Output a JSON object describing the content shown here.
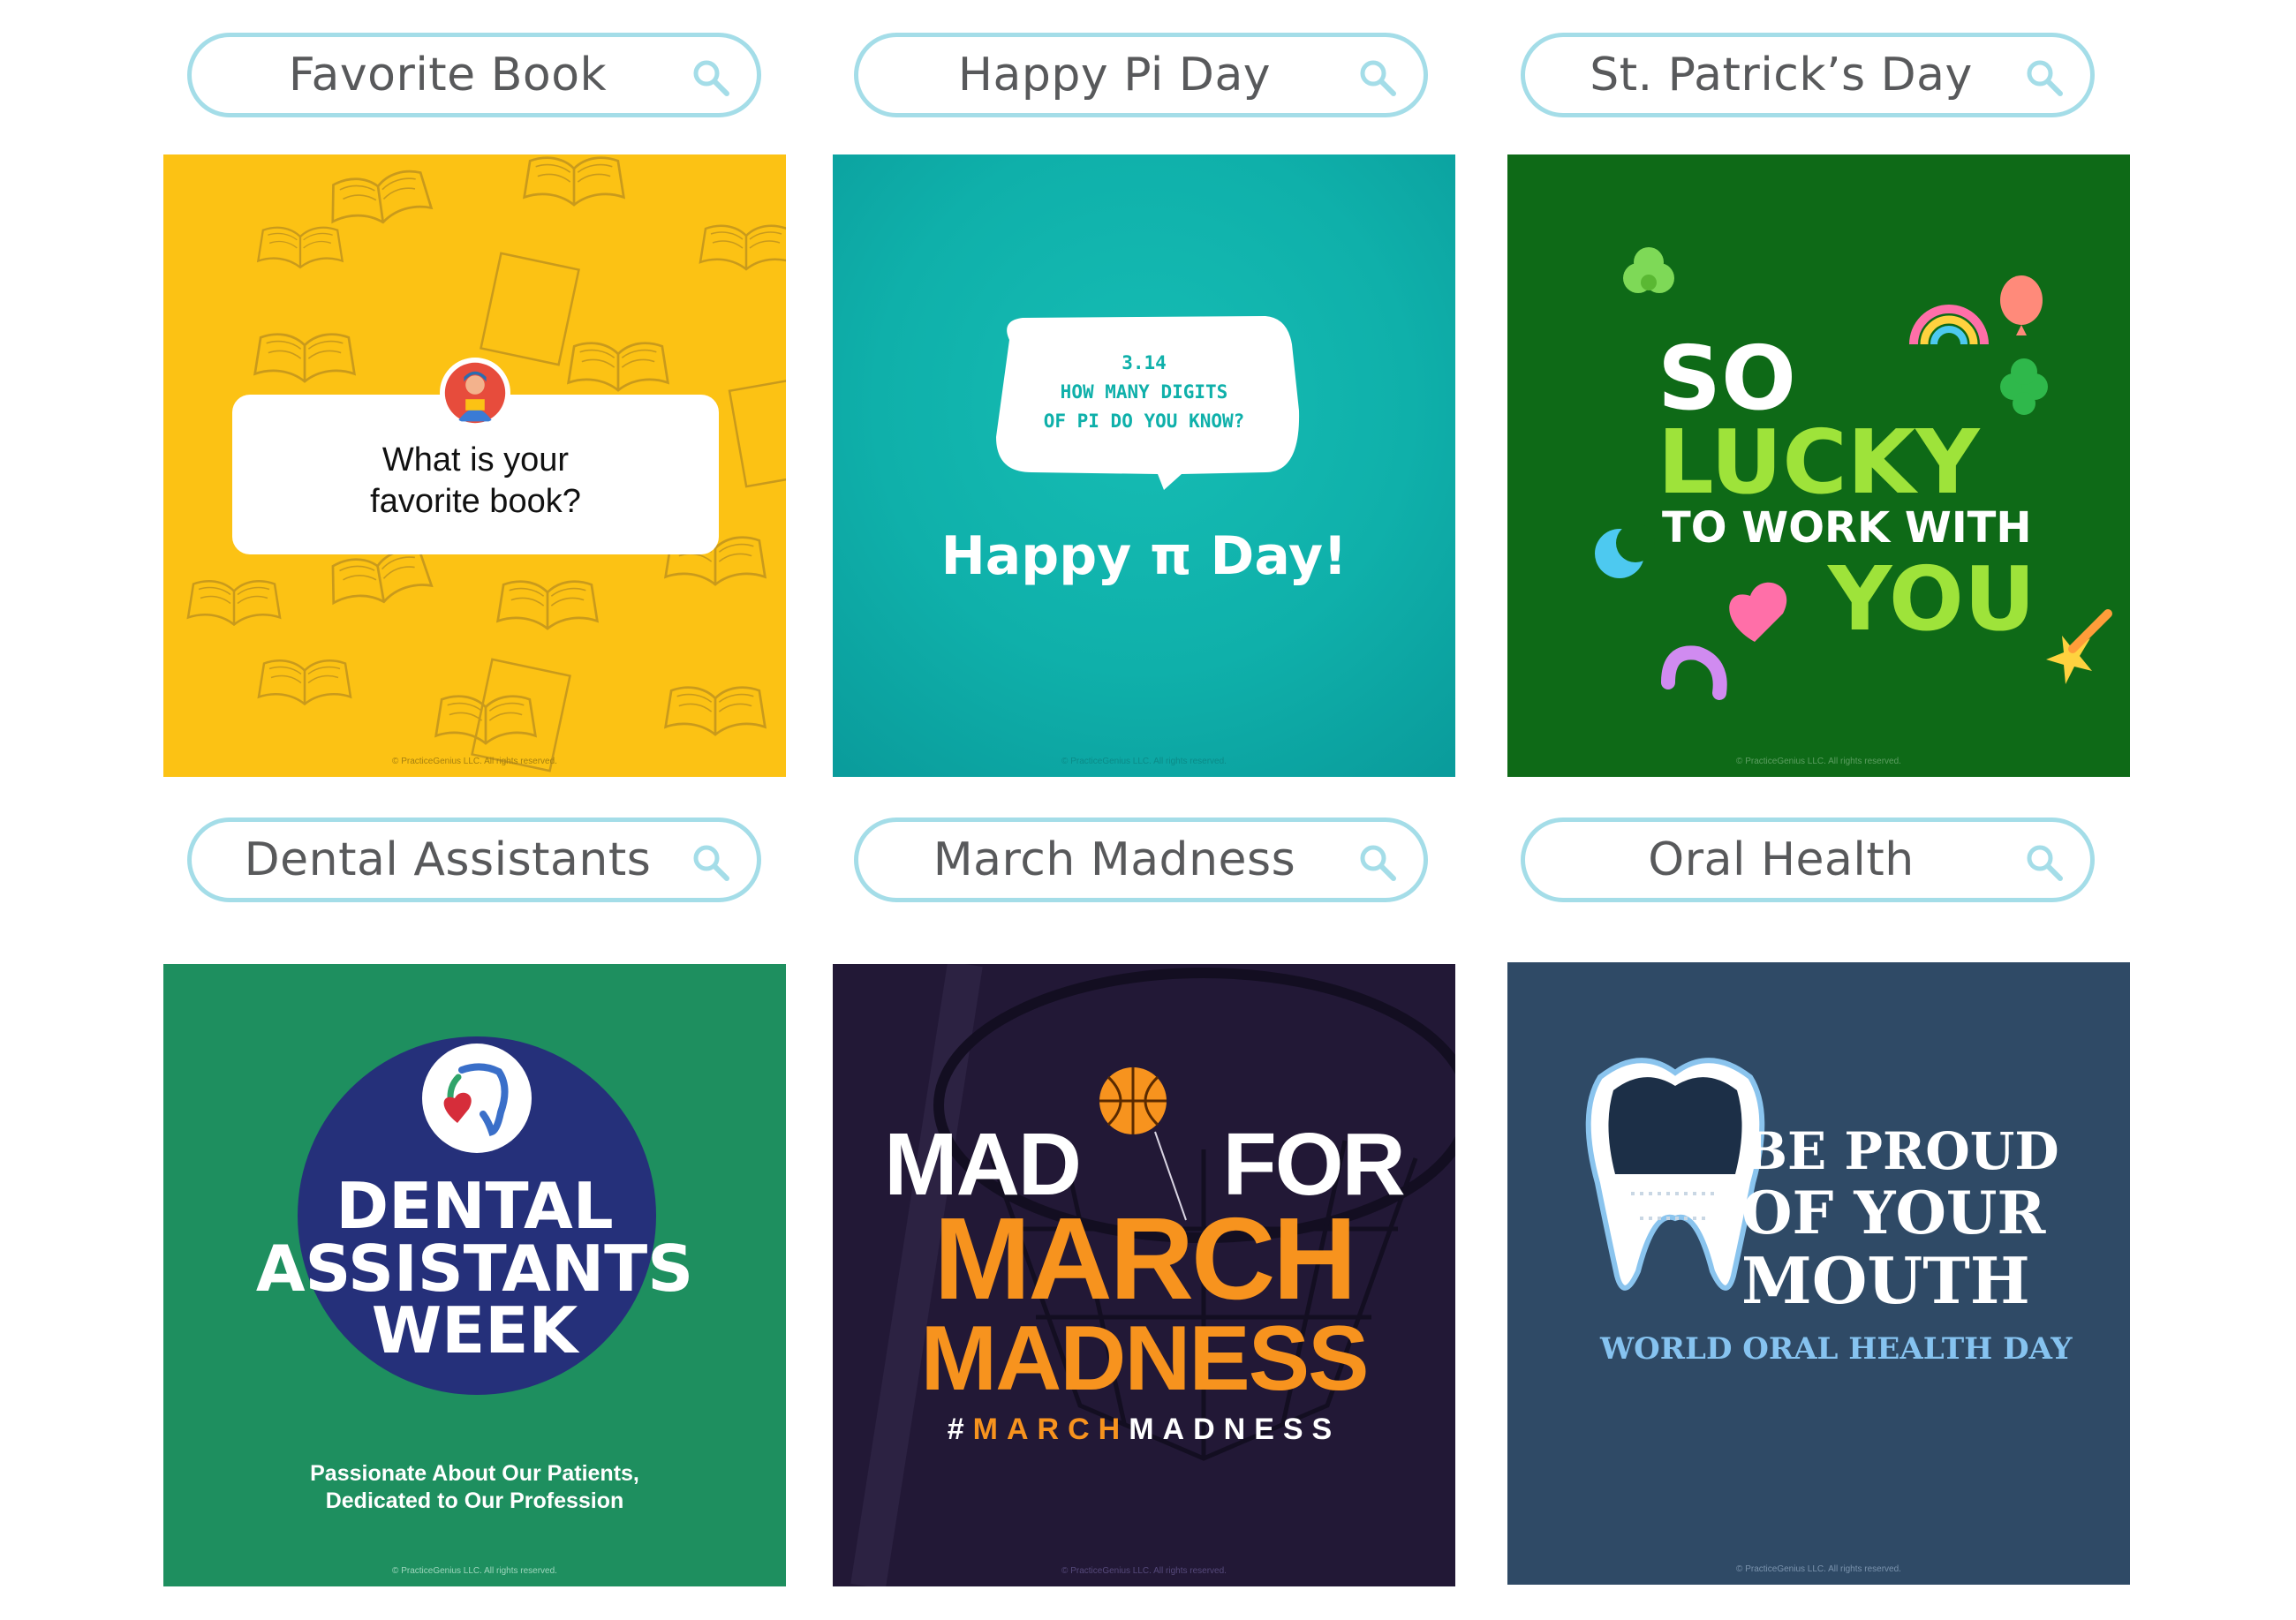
{
  "colors": {
    "pill_border": "#a4dde8",
    "pill_text": "#58595b",
    "search_icon": "#a4dde8"
  },
  "search_pills": [
    {
      "label": "Favorite Book",
      "icon": "search-icon"
    },
    {
      "label": "Happy Pi Day",
      "icon": "search-icon"
    },
    {
      "label": "St. Patrick’s Day",
      "icon": "search-icon"
    },
    {
      "label": "Dental Assistants",
      "icon": "search-icon"
    },
    {
      "label": "March Madness",
      "icon": "search-icon"
    },
    {
      "label": "Oral Health",
      "icon": "search-icon"
    }
  ],
  "tiles": {
    "favorite_book": {
      "question": "What is your\nfavorite book?",
      "background": "#fcc214",
      "copyright": "© PracticeGenius LLC. All rights reserved."
    },
    "pi_day": {
      "bubble": "3.14\nHOW MANY DIGITS\nOF PI DO YOU KNOW?",
      "title": "Happy π Day!",
      "background": "#0fb0aa",
      "copyright": "© PracticeGenius LLC. All rights reserved."
    },
    "st_patricks": {
      "line1": "SO",
      "line2": "LUCKY",
      "line3": "TO WORK WITH",
      "line4": "YOU",
      "background": "#0e6a17",
      "copyright": "© PracticeGenius LLC. All rights reserved."
    },
    "dental_assistants": {
      "line1": "DENTAL",
      "line2": "ASSISTANTS",
      "line3": "WEEK",
      "tagline1": "Passionate About Our Patients,",
      "tagline2": "Dedicated to Our Profession",
      "background": "#1e8f5f",
      "copyright": "© PracticeGenius LLC. All rights reserved."
    },
    "march_madness": {
      "line1_left": "MAD",
      "line1_right": "FOR",
      "line2": "MARCH",
      "line3": "MADNESS",
      "hashtag_hash": "#",
      "hashtag_part1": "MARCH",
      "hashtag_part2": "MADNESS",
      "background": "#221836",
      "copyright": "© PracticeGenius LLC. All rights reserved."
    },
    "oral_health": {
      "line1": "BE PROUD",
      "line2": "OF YOUR",
      "line3": "MOUTH",
      "subtitle": "WORLD ORAL HEALTH DAY",
      "background": "#2f4a66",
      "copyright": "© PracticeGenius LLC. All rights reserved."
    }
  }
}
